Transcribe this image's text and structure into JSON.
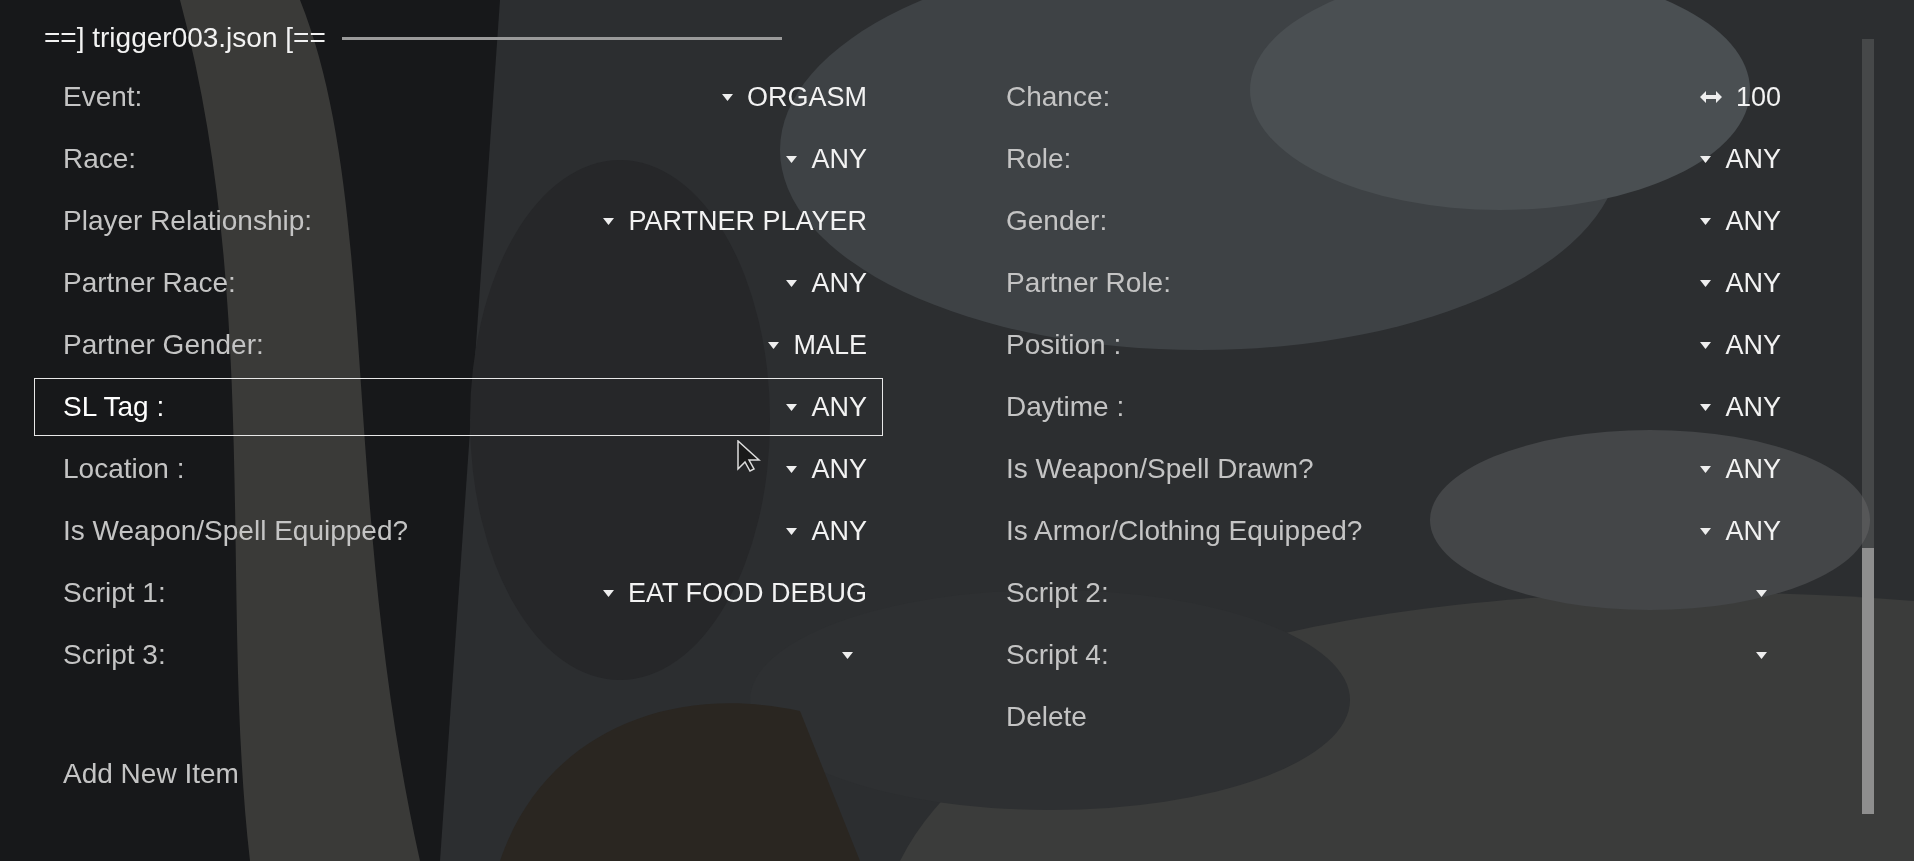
{
  "header": {
    "title": "==] trigger003.json [=="
  },
  "left_column": [
    {
      "label": "Event:",
      "kind": "menu",
      "value": "ORGASM",
      "selected": false
    },
    {
      "label": "Race:",
      "kind": "menu",
      "value": "ANY",
      "selected": false
    },
    {
      "label": "Player Relationship:",
      "kind": "menu",
      "value": "PARTNER PLAYER",
      "selected": false
    },
    {
      "label": "Partner Race:",
      "kind": "menu",
      "value": "ANY",
      "selected": false
    },
    {
      "label": "Partner Gender:",
      "kind": "menu",
      "value": "MALE",
      "selected": false
    },
    {
      "label": "SL Tag :",
      "kind": "menu",
      "value": "ANY",
      "selected": true
    },
    {
      "label": "Location :",
      "kind": "menu",
      "value": "ANY",
      "selected": false
    },
    {
      "label": "Is Weapon/Spell Equipped?",
      "kind": "menu",
      "value": "ANY",
      "selected": false
    },
    {
      "label": "Script 1:",
      "kind": "menu",
      "value": "EAT FOOD DEBUG",
      "selected": false
    },
    {
      "label": "Script 3:",
      "kind": "menu",
      "selected": false
    }
  ],
  "right_column": [
    {
      "label": "Chance:",
      "kind": "slider",
      "value": "100",
      "selected": false
    },
    {
      "label": "Role:",
      "kind": "menu",
      "value": "ANY",
      "selected": false
    },
    {
      "label": "Gender:",
      "kind": "menu",
      "value": "ANY",
      "selected": false
    },
    {
      "label": "Partner Role:",
      "kind": "menu",
      "value": "ANY",
      "selected": false
    },
    {
      "label": "Position :",
      "kind": "menu",
      "value": "ANY",
      "selected": false
    },
    {
      "label": "Daytime :",
      "kind": "menu",
      "value": "ANY",
      "selected": false
    },
    {
      "label": "Is Weapon/Spell Drawn?",
      "kind": "menu",
      "value": "ANY",
      "selected": false
    },
    {
      "label": "Is Armor/Clothing Equipped?",
      "kind": "menu",
      "value": "ANY",
      "selected": false
    },
    {
      "label": "Script 2:",
      "kind": "menu",
      "selected": false
    },
    {
      "label": "Script 4:",
      "kind": "menu",
      "selected": false
    },
    {
      "label": "Delete",
      "kind": "text",
      "selected": false
    }
  ],
  "add_item": {
    "label": "Add New Item"
  }
}
